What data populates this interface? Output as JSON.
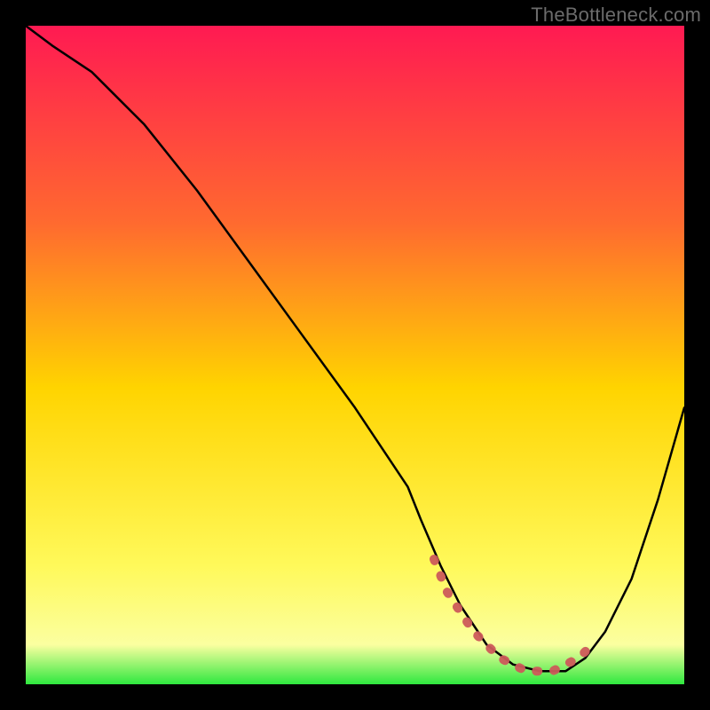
{
  "attribution": "TheBottleneck.com",
  "chart_data": {
    "type": "line",
    "title": "",
    "xlabel": "",
    "ylabel": "",
    "xlim": [
      0,
      100
    ],
    "ylim": [
      0,
      100
    ],
    "gradient_stops": [
      {
        "offset": 0,
        "color": "#ff1a52"
      },
      {
        "offset": 30,
        "color": "#ff6a2f"
      },
      {
        "offset": 55,
        "color": "#ffd400"
      },
      {
        "offset": 82,
        "color": "#fff95a"
      },
      {
        "offset": 94,
        "color": "#fbffa0"
      },
      {
        "offset": 100,
        "color": "#2fe83f"
      }
    ],
    "series": [
      {
        "name": "bottleneck-curve",
        "color": "#000000",
        "x": [
          0,
          4,
          10,
          18,
          26,
          34,
          42,
          50,
          58,
          60,
          63,
          66,
          70,
          74,
          78,
          82,
          85,
          88,
          92,
          96,
          100
        ],
        "y": [
          100,
          97,
          93,
          85,
          75,
          64,
          53,
          42,
          30,
          25,
          18,
          12,
          6,
          3,
          2,
          2,
          4,
          8,
          16,
          28,
          42
        ]
      }
    ],
    "markers": {
      "name": "optimal-range-markers",
      "color": "#cc5a5a",
      "x": [
        62,
        64,
        66,
        68,
        70,
        72,
        74,
        76,
        78,
        80,
        82,
        84,
        86
      ],
      "y": [
        19,
        14,
        11,
        8,
        6,
        4,
        3,
        2,
        2,
        2,
        3,
        4,
        6
      ]
    }
  }
}
